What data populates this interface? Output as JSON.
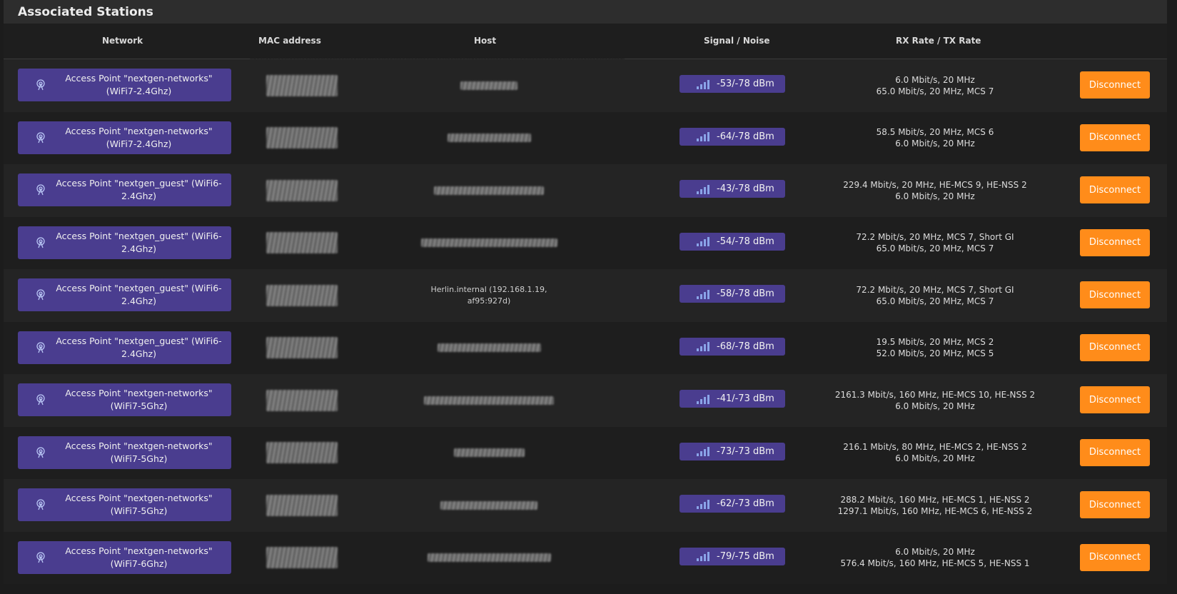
{
  "section": {
    "title": "Associated Stations"
  },
  "columns": {
    "network": "Network",
    "mac": "MAC address",
    "host": "Host",
    "signal": "Signal / Noise",
    "rate": "RX Rate / TX Rate"
  },
  "colors": {
    "badge": "#4a3d8f",
    "button": "#ff8c1a"
  },
  "rows": [
    {
      "network_line1": "Access Point \"nextgen-networks\"",
      "network_line2": "(WiFi7-2.4Ghz)",
      "host_line1": "",
      "host_line2": "",
      "signal": "-53/-78 dBm",
      "rx": "6.0 Mbit/s, 20 MHz",
      "tx": "65.0 Mbit/s, 20 MHz, MCS 7",
      "action": "Disconnect"
    },
    {
      "network_line1": "Access Point \"nextgen-networks\"",
      "network_line2": "(WiFi7-2.4Ghz)",
      "host_line1": "",
      "host_line2": "",
      "signal": "-64/-78 dBm",
      "rx": "58.5 Mbit/s, 20 MHz, MCS 6",
      "tx": "6.0 Mbit/s, 20 MHz",
      "action": "Disconnect"
    },
    {
      "network_line1": "Access Point \"nextgen_guest\" (WiFi6-",
      "network_line2": "2.4Ghz)",
      "host_line1": "",
      "host_line2": "",
      "signal": "-43/-78 dBm",
      "rx": "229.4 Mbit/s, 20 MHz, HE-MCS 9, HE-NSS 2",
      "tx": "6.0 Mbit/s, 20 MHz",
      "action": "Disconnect"
    },
    {
      "network_line1": "Access Point \"nextgen_guest\" (WiFi6-",
      "network_line2": "2.4Ghz)",
      "host_line1": "",
      "host_line2": "",
      "signal": "-54/-78 dBm",
      "rx": "72.2 Mbit/s, 20 MHz, MCS 7, Short GI",
      "tx": "65.0 Mbit/s, 20 MHz, MCS 7",
      "action": "Disconnect"
    },
    {
      "network_line1": "Access Point \"nextgen_guest\" (WiFi6-",
      "network_line2": "2.4Ghz)",
      "host_line1": "Herlin.internal (192.168.1.19,",
      "host_line2": "af95:927d)",
      "signal": "-58/-78 dBm",
      "rx": "72.2 Mbit/s, 20 MHz, MCS 7, Short GI",
      "tx": "65.0 Mbit/s, 20 MHz, MCS 7",
      "action": "Disconnect"
    },
    {
      "network_line1": "Access Point \"nextgen_guest\" (WiFi6-",
      "network_line2": "2.4Ghz)",
      "host_line1": "",
      "host_line2": "",
      "signal": "-68/-78 dBm",
      "rx": "19.5 Mbit/s, 20 MHz, MCS 2",
      "tx": "52.0 Mbit/s, 20 MHz, MCS 5",
      "action": "Disconnect"
    },
    {
      "network_line1": "Access Point \"nextgen-networks\"",
      "network_line2": "(WiFi7-5Ghz)",
      "host_line1": "",
      "host_line2": "",
      "signal": "-41/-73 dBm",
      "rx": "2161.3 Mbit/s, 160 MHz, HE-MCS 10, HE-NSS 2",
      "tx": "6.0 Mbit/s, 20 MHz",
      "action": "Disconnect"
    },
    {
      "network_line1": "Access Point \"nextgen-networks\"",
      "network_line2": "(WiFi7-5Ghz)",
      "host_line1": "",
      "host_line2": "",
      "signal": "-73/-73 dBm",
      "rx": "216.1 Mbit/s, 80 MHz, HE-MCS 2, HE-NSS 2",
      "tx": "6.0 Mbit/s, 20 MHz",
      "action": "Disconnect"
    },
    {
      "network_line1": "Access Point \"nextgen-networks\"",
      "network_line2": "(WiFi7-5Ghz)",
      "host_line1": "",
      "host_line2": "",
      "signal": "-62/-73 dBm",
      "rx": "288.2 Mbit/s, 160 MHz, HE-MCS 1, HE-NSS 2",
      "tx": "1297.1 Mbit/s, 160 MHz, HE-MCS 6, HE-NSS 2",
      "action": "Disconnect"
    },
    {
      "network_line1": "Access Point \"nextgen-networks\"",
      "network_line2": "(WiFi7-6Ghz)",
      "host_line1": "",
      "host_line2": "",
      "signal": "-79/-75 dBm",
      "rx": "6.0 Mbit/s, 20 MHz",
      "tx": "576.4 Mbit/s, 160 MHz, HE-MCS 5, HE-NSS 1",
      "action": "Disconnect"
    }
  ]
}
